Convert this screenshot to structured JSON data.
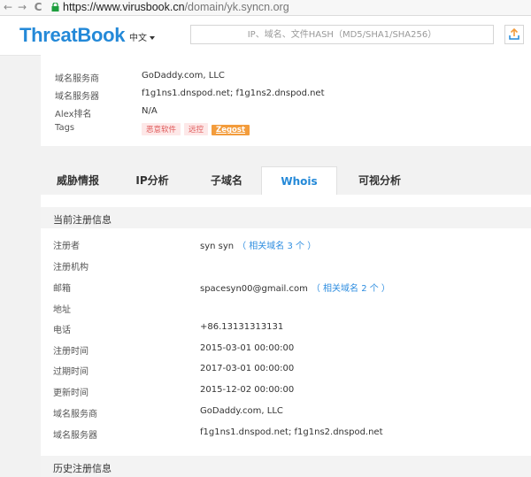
{
  "browser": {
    "back": "←",
    "forward": "→",
    "reload": "C",
    "url_host": "https://www.virusbook.cn",
    "url_path": "/domain/yk.syncn.org"
  },
  "header": {
    "logo": "ThreatBook",
    "lang": "中文",
    "search_placeholder": "IP、域名、文件HASH（MD5/SHA1/SHA256）"
  },
  "info": {
    "rows": [
      {
        "key": "域名服务商",
        "value": "GoDaddy.com, LLC"
      },
      {
        "key": "域名服务器",
        "value": "f1g1ns1.dnspod.net; f1g1ns2.dnspod.net"
      },
      {
        "key": "Alex排名",
        "value": "N/A"
      },
      {
        "key": "Tags",
        "value": ""
      }
    ],
    "tags": [
      "恶意软件",
      "远控",
      "Zegost"
    ]
  },
  "tabs": [
    "威胁情报",
    "IP分析",
    "子域名",
    "Whois",
    "可视分析"
  ],
  "whois": {
    "section_title": "当前注册信息",
    "rows": [
      {
        "key": "注册者",
        "value": "syn syn",
        "link": "（ 相关域名 3 个 ）"
      },
      {
        "key": "注册机构",
        "value": ""
      },
      {
        "key": "邮箱",
        "value": "spacesyn00@gmail.com",
        "link": "（ 相关域名 2 个 ）"
      },
      {
        "key": "地址",
        "value": ""
      },
      {
        "key": "电话",
        "value": "+86.13131313131"
      },
      {
        "key": "注册时间",
        "value": "2015-03-01 00:00:00"
      },
      {
        "key": "过期时间",
        "value": "2017-03-01 00:00:00"
      },
      {
        "key": "更新时间",
        "value": "2015-12-02 00:00:00"
      },
      {
        "key": "域名服务商",
        "value": "GoDaddy.com, LLC"
      },
      {
        "key": "域名服务器",
        "value": "f1g1ns1.dnspod.net; f1g1ns2.dnspod.net"
      }
    ],
    "history_title": "历史注册信息"
  },
  "colors": {
    "brand": "#2489d8",
    "link": "#2f8ee0",
    "tag_orange": "#f39c3c",
    "tag_red": "#e05a5a"
  }
}
